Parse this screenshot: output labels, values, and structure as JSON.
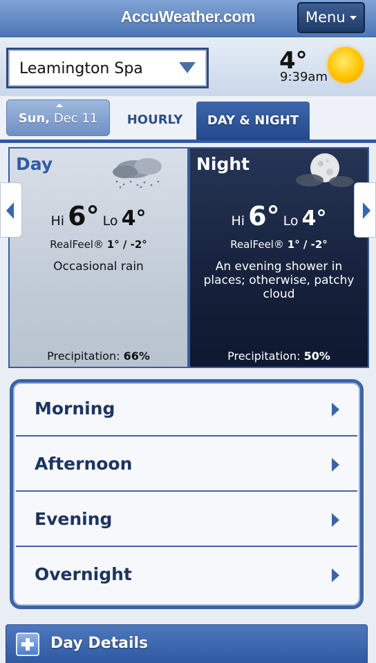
{
  "header": {
    "brand": "AccuWeather.com",
    "menu_label": "Menu"
  },
  "location": {
    "name": "Leamington Spa",
    "current_temp": "4°",
    "time": "9:39am",
    "icon": "sun-icon"
  },
  "tabs": {
    "date_day": "Sun,",
    "date_rest": " Dec 11",
    "hourly": "HOURLY",
    "day_night": "DAY & NIGHT"
  },
  "day": {
    "title": "Day",
    "hi_label": "Hi",
    "hi_value": "6°",
    "lo_label": "Lo",
    "lo_value": "4°",
    "realfeel_label": "RealFeel®",
    "realfeel_value": "1° / -2°",
    "condition": "Occasional rain",
    "precip_label": "Precipitation:",
    "precip_value": "66%",
    "icon": "rain-cloud-icon"
  },
  "night": {
    "title": "Night",
    "hi_label": "Hi",
    "hi_value": "6°",
    "lo_label": "Lo",
    "lo_value": "4°",
    "realfeel_label": "RealFeel®",
    "realfeel_value": "1° / -2°",
    "condition": "An evening shower in places; otherwise, patchy cloud",
    "precip_label": "Precipitation:",
    "precip_value": "50%",
    "icon": "moon-cloud-icon"
  },
  "periods": [
    {
      "label": "Morning"
    },
    {
      "label": "Afternoon"
    },
    {
      "label": "Evening"
    },
    {
      "label": "Overnight"
    }
  ],
  "details": {
    "label": "Day Details"
  },
  "colors": {
    "accent": "#2f5aa6",
    "night_bg": "#131e37",
    "brand_header": "#4d77b5"
  }
}
